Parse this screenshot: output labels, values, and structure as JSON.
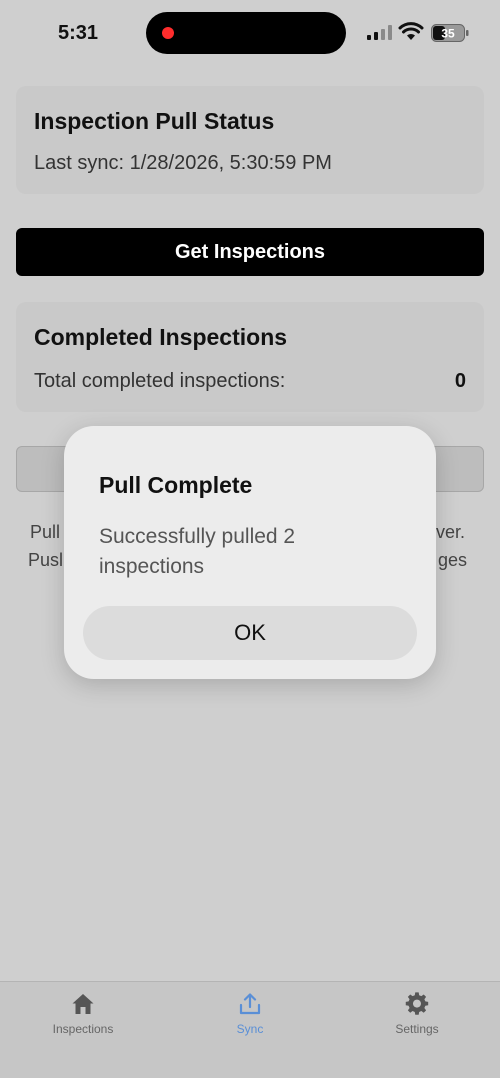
{
  "status_bar": {
    "time": "5:31",
    "battery": "35"
  },
  "pull_status": {
    "title": "Inspection Pull Status",
    "last_sync": "Last sync: 1/28/2026, 5:30:59 PM"
  },
  "get_button_label": "Get Inspections",
  "completed": {
    "title": "Completed Inspections",
    "total_label": "Total completed inspections:",
    "total_value": "0"
  },
  "help_text": {
    "line1": "Pull",
    "line1_end": "ver.",
    "line2": "Pusl",
    "line2_end": "ges"
  },
  "modal": {
    "title": "Pull Complete",
    "message": "Successfully pulled 2 inspections",
    "ok_label": "OK"
  },
  "tabs": [
    {
      "label": "Inspections",
      "icon": "home-icon"
    },
    {
      "label": "Sync",
      "icon": "upload-icon",
      "active": true
    },
    {
      "label": "Settings",
      "icon": "gear-icon"
    }
  ],
  "colors": {
    "accent": "#5a8fd6",
    "primary_button": "#000000"
  }
}
